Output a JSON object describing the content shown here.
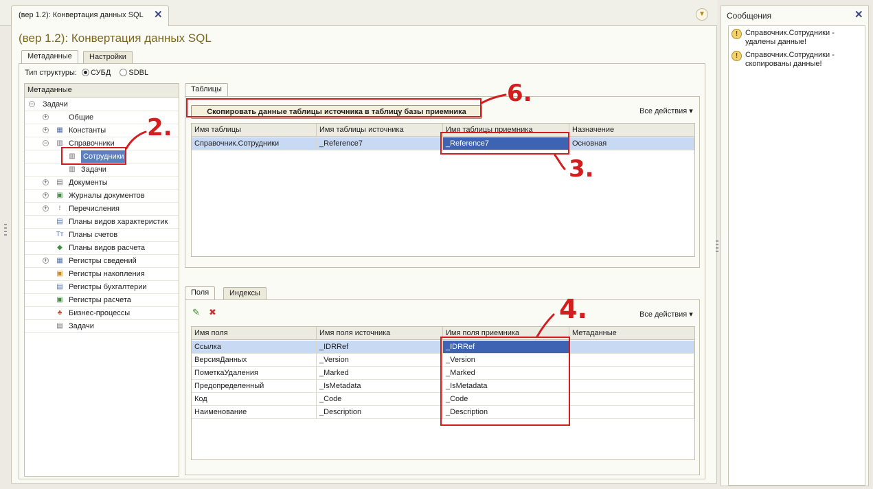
{
  "window": {
    "tab_title": "(вер 1.2): Конвертация данных SQL",
    "page_title": "(вер 1.2): Конвертация данных SQL",
    "menu_glyph": "▼"
  },
  "page_tabs": [
    {
      "label": "Метаданные",
      "active": true
    },
    {
      "label": "Настройки",
      "active": false
    }
  ],
  "structure": {
    "label": "Тип структуры:",
    "options": [
      {
        "label": "СУБД",
        "checked": true
      },
      {
        "label": "SDBL",
        "checked": false
      }
    ]
  },
  "tree": {
    "header": "Метаданные",
    "items": [
      {
        "label": "Задачи",
        "level": 0,
        "expander": "⊖",
        "icon": ""
      },
      {
        "label": "Общие",
        "level": 1,
        "expander": "⊕",
        "icon": ""
      },
      {
        "label": "Константы",
        "level": 1,
        "expander": "⊕",
        "icon": "constants-icon"
      },
      {
        "label": "Справочники",
        "level": 1,
        "expander": "⊖",
        "icon": "catalog-icon"
      },
      {
        "label": "Сотрудники",
        "level": 2,
        "expander": "",
        "icon": "table-icon",
        "selected": true
      },
      {
        "label": "Задачи",
        "level": 2,
        "expander": "",
        "icon": "table-icon"
      },
      {
        "label": "Документы",
        "level": 1,
        "expander": "⊕",
        "icon": "document-icon"
      },
      {
        "label": "Журналы документов",
        "level": 1,
        "expander": "⊕",
        "icon": "journal-icon"
      },
      {
        "label": "Перечисления",
        "level": 1,
        "expander": "⊕",
        "icon": "enum-icon"
      },
      {
        "label": "Планы видов характеристик",
        "level": 1,
        "expander": "",
        "icon": "chart-types-icon"
      },
      {
        "label": "Планы счетов",
        "level": 1,
        "expander": "",
        "icon": "accounts-icon"
      },
      {
        "label": "Планы видов расчета",
        "level": 1,
        "expander": "",
        "icon": "calc-types-icon"
      },
      {
        "label": "Регистры сведений",
        "level": 1,
        "expander": "⊕",
        "icon": "info-register-icon"
      },
      {
        "label": "Регистры накопления",
        "level": 1,
        "expander": "",
        "icon": "accum-register-icon"
      },
      {
        "label": "Регистры бухгалтерии",
        "level": 1,
        "expander": "",
        "icon": "account-register-icon"
      },
      {
        "label": "Регистры расчета",
        "level": 1,
        "expander": "",
        "icon": "calc-register-icon"
      },
      {
        "label": "Бизнес-процессы",
        "level": 1,
        "expander": "",
        "icon": "business-process-icon"
      },
      {
        "label": "Задачи",
        "level": 1,
        "expander": "",
        "icon": "task-icon"
      }
    ]
  },
  "tables_section": {
    "tab": "Таблицы",
    "copy_button": "Скопировать данные таблицы источника в таблицу базы приемника",
    "all_actions": "Все действия ▾",
    "columns": [
      "Имя таблицы",
      "Имя таблицы источника",
      "Имя таблицы приемника",
      "Назначение"
    ],
    "rows": [
      [
        "Справочник.Сотрудники",
        "_Reference7",
        "_Reference7",
        "Основная"
      ]
    ]
  },
  "fields_section": {
    "tabs": [
      {
        "label": "Поля",
        "active": true
      },
      {
        "label": "Индексы",
        "active": false
      }
    ],
    "edit_glyph": "✎",
    "delete_glyph": "✖",
    "all_actions": "Все действия ▾",
    "columns": [
      "Имя поля",
      "Имя поля источника",
      "Имя поля приемника",
      "Метаданные"
    ],
    "rows": [
      [
        "Ссылка",
        "_IDRRef",
        "_IDRRef",
        ""
      ],
      [
        "ВерсияДанных",
        "_Version",
        "_Version",
        ""
      ],
      [
        "ПометкаУдаления",
        "_Marked",
        "_Marked",
        ""
      ],
      [
        "Предопределенный",
        "_IsMetadata",
        "_IsMetadata",
        ""
      ],
      [
        "Код",
        "_Code",
        "_Code",
        ""
      ],
      [
        "Наименование",
        "_Description",
        "_Description",
        ""
      ]
    ]
  },
  "annotations": {
    "n2": "2.",
    "n3": "3.",
    "n4": "4.",
    "n6": "6."
  },
  "messages": {
    "title": "Сообщения",
    "items": [
      {
        "text": "Справочник.Сотрудники - удалены данные!"
      },
      {
        "text": "Справочник.Сотрудники - скопированы данные!"
      }
    ]
  },
  "colors": {
    "accent_title": "#7b6624",
    "selection": "#3e63b3",
    "annotation": "#d21e1e"
  }
}
